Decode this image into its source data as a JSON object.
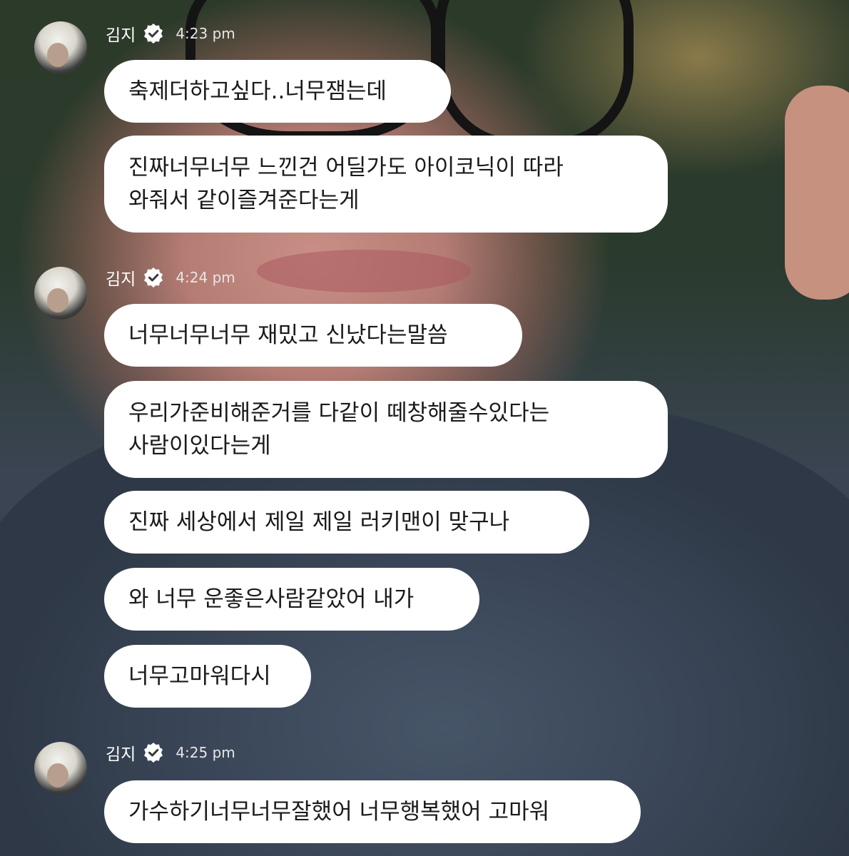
{
  "groups": [
    {
      "username": "김지",
      "time": "4:23 pm",
      "messages": [
        "축제더하고싶다..너무잼는데",
        "진짜너무너무 느낀건 어딜가도 아이코닉이 따라\n와줘서 같이즐겨준다는게"
      ]
    },
    {
      "username": "김지",
      "time": "4:24 pm",
      "messages": [
        "너무너무너무 재밌고 신났다는말씀",
        "우리가준비해준거를 다같이 떼창해줄수있다는\n사람이있다는게",
        "진짜 세상에서 제일 제일 러키맨이 맞구나",
        "와 너무 운좋은사람같았어 내가",
        "너무고마워다시"
      ]
    },
    {
      "username": "김지",
      "time": "4:25 pm",
      "messages": [
        "가수하기너무너무잘했어 너무행복했어 고마워"
      ]
    }
  ],
  "icons": {
    "verified": "verified-check-icon",
    "avatar": "profile-avatar"
  },
  "colors": {
    "bubble": "#ffffff",
    "text": "#1a1a1a",
    "meta": "#e6e6e6"
  }
}
